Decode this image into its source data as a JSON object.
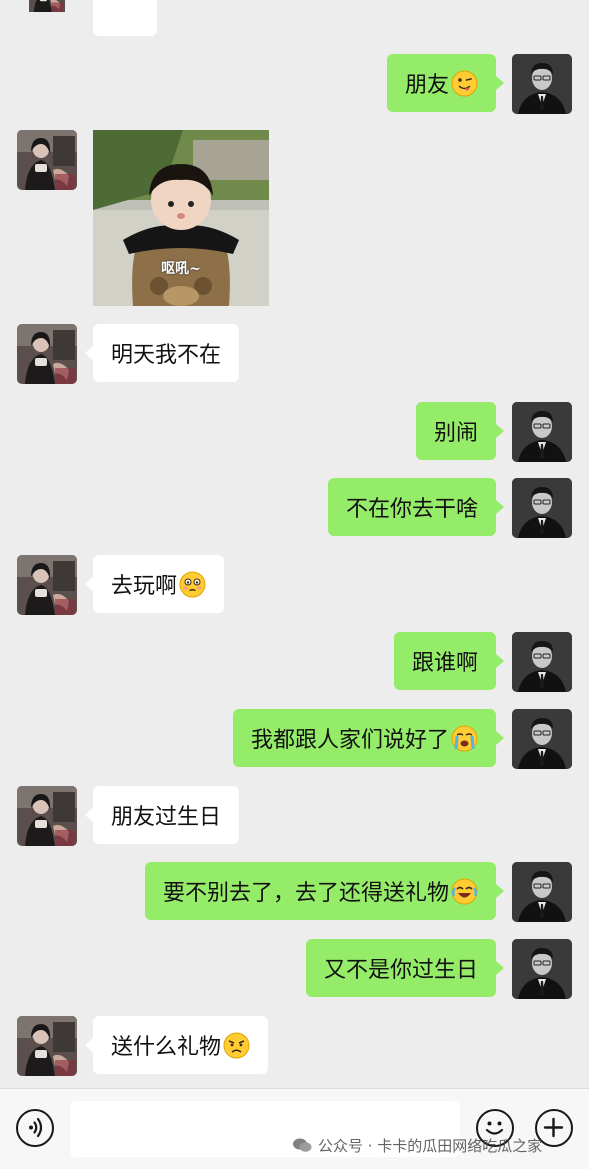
{
  "colors": {
    "background": "#ededed",
    "sent_bubble": "#95ec69",
    "received_bubble": "#ffffff"
  },
  "messages": [
    {
      "side": "received",
      "type": "text",
      "text": "",
      "partial": true
    },
    {
      "side": "sent",
      "type": "text",
      "text": "朋友",
      "emoji": "winking-tongue-emoji"
    },
    {
      "side": "received",
      "type": "sticker",
      "text": "呕吼~"
    },
    {
      "side": "received",
      "type": "text",
      "text": "明天我不在"
    },
    {
      "side": "sent",
      "type": "text",
      "text": "别闹"
    },
    {
      "side": "sent",
      "type": "text",
      "text": "不在你去干啥"
    },
    {
      "side": "received",
      "type": "text",
      "text": "去玩啊",
      "emoji": "flushed-emoji"
    },
    {
      "side": "sent",
      "type": "text",
      "text": "跟谁啊"
    },
    {
      "side": "sent",
      "type": "text",
      "text": "我都跟人家们说好了",
      "emoji": "crying-emoji"
    },
    {
      "side": "received",
      "type": "text",
      "text": "朋友过生日"
    },
    {
      "side": "sent",
      "type": "text",
      "text": "要不别去了，去了还得送礼物",
      "emoji": "laughing-tears-emoji"
    },
    {
      "side": "sent",
      "type": "text",
      "text": "又不是你过生日"
    },
    {
      "side": "received",
      "type": "text",
      "text": "送什么礼物",
      "emoji": "confused-emoji"
    }
  ],
  "input_bar": {
    "value": "",
    "placeholder": ""
  },
  "watermark": {
    "text": "公众号 · 卡卡的瓜田网络吃瓜之家"
  }
}
